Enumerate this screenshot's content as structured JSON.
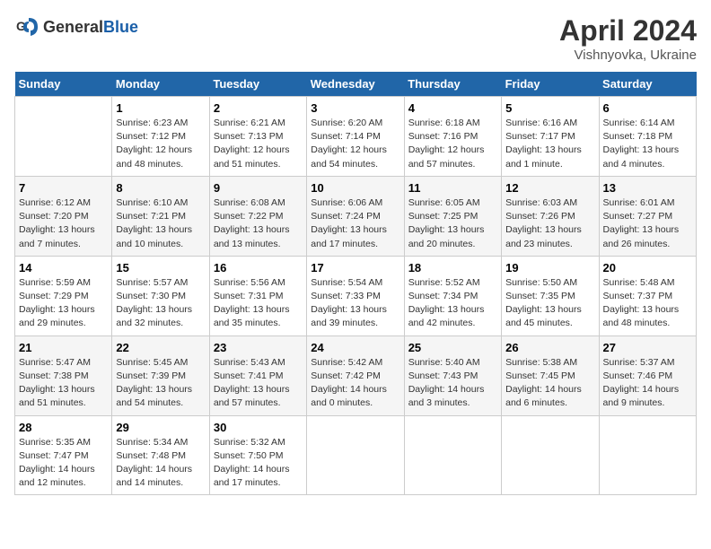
{
  "header": {
    "logo_general": "General",
    "logo_blue": "Blue",
    "title": "April 2024",
    "subtitle": "Vishnyovka, Ukraine"
  },
  "calendar": {
    "weekdays": [
      "Sunday",
      "Monday",
      "Tuesday",
      "Wednesday",
      "Thursday",
      "Friday",
      "Saturday"
    ],
    "weeks": [
      [
        {
          "day": "",
          "info": ""
        },
        {
          "day": "1",
          "info": "Sunrise: 6:23 AM\nSunset: 7:12 PM\nDaylight: 12 hours\nand 48 minutes."
        },
        {
          "day": "2",
          "info": "Sunrise: 6:21 AM\nSunset: 7:13 PM\nDaylight: 12 hours\nand 51 minutes."
        },
        {
          "day": "3",
          "info": "Sunrise: 6:20 AM\nSunset: 7:14 PM\nDaylight: 12 hours\nand 54 minutes."
        },
        {
          "day": "4",
          "info": "Sunrise: 6:18 AM\nSunset: 7:16 PM\nDaylight: 12 hours\nand 57 minutes."
        },
        {
          "day": "5",
          "info": "Sunrise: 6:16 AM\nSunset: 7:17 PM\nDaylight: 13 hours\nand 1 minute."
        },
        {
          "day": "6",
          "info": "Sunrise: 6:14 AM\nSunset: 7:18 PM\nDaylight: 13 hours\nand 4 minutes."
        }
      ],
      [
        {
          "day": "7",
          "info": "Sunrise: 6:12 AM\nSunset: 7:20 PM\nDaylight: 13 hours\nand 7 minutes."
        },
        {
          "day": "8",
          "info": "Sunrise: 6:10 AM\nSunset: 7:21 PM\nDaylight: 13 hours\nand 10 minutes."
        },
        {
          "day": "9",
          "info": "Sunrise: 6:08 AM\nSunset: 7:22 PM\nDaylight: 13 hours\nand 13 minutes."
        },
        {
          "day": "10",
          "info": "Sunrise: 6:06 AM\nSunset: 7:24 PM\nDaylight: 13 hours\nand 17 minutes."
        },
        {
          "day": "11",
          "info": "Sunrise: 6:05 AM\nSunset: 7:25 PM\nDaylight: 13 hours\nand 20 minutes."
        },
        {
          "day": "12",
          "info": "Sunrise: 6:03 AM\nSunset: 7:26 PM\nDaylight: 13 hours\nand 23 minutes."
        },
        {
          "day": "13",
          "info": "Sunrise: 6:01 AM\nSunset: 7:27 PM\nDaylight: 13 hours\nand 26 minutes."
        }
      ],
      [
        {
          "day": "14",
          "info": "Sunrise: 5:59 AM\nSunset: 7:29 PM\nDaylight: 13 hours\nand 29 minutes."
        },
        {
          "day": "15",
          "info": "Sunrise: 5:57 AM\nSunset: 7:30 PM\nDaylight: 13 hours\nand 32 minutes."
        },
        {
          "day": "16",
          "info": "Sunrise: 5:56 AM\nSunset: 7:31 PM\nDaylight: 13 hours\nand 35 minutes."
        },
        {
          "day": "17",
          "info": "Sunrise: 5:54 AM\nSunset: 7:33 PM\nDaylight: 13 hours\nand 39 minutes."
        },
        {
          "day": "18",
          "info": "Sunrise: 5:52 AM\nSunset: 7:34 PM\nDaylight: 13 hours\nand 42 minutes."
        },
        {
          "day": "19",
          "info": "Sunrise: 5:50 AM\nSunset: 7:35 PM\nDaylight: 13 hours\nand 45 minutes."
        },
        {
          "day": "20",
          "info": "Sunrise: 5:48 AM\nSunset: 7:37 PM\nDaylight: 13 hours\nand 48 minutes."
        }
      ],
      [
        {
          "day": "21",
          "info": "Sunrise: 5:47 AM\nSunset: 7:38 PM\nDaylight: 13 hours\nand 51 minutes."
        },
        {
          "day": "22",
          "info": "Sunrise: 5:45 AM\nSunset: 7:39 PM\nDaylight: 13 hours\nand 54 minutes."
        },
        {
          "day": "23",
          "info": "Sunrise: 5:43 AM\nSunset: 7:41 PM\nDaylight: 13 hours\nand 57 minutes."
        },
        {
          "day": "24",
          "info": "Sunrise: 5:42 AM\nSunset: 7:42 PM\nDaylight: 14 hours\nand 0 minutes."
        },
        {
          "day": "25",
          "info": "Sunrise: 5:40 AM\nSunset: 7:43 PM\nDaylight: 14 hours\nand 3 minutes."
        },
        {
          "day": "26",
          "info": "Sunrise: 5:38 AM\nSunset: 7:45 PM\nDaylight: 14 hours\nand 6 minutes."
        },
        {
          "day": "27",
          "info": "Sunrise: 5:37 AM\nSunset: 7:46 PM\nDaylight: 14 hours\nand 9 minutes."
        }
      ],
      [
        {
          "day": "28",
          "info": "Sunrise: 5:35 AM\nSunset: 7:47 PM\nDaylight: 14 hours\nand 12 minutes."
        },
        {
          "day": "29",
          "info": "Sunrise: 5:34 AM\nSunset: 7:48 PM\nDaylight: 14 hours\nand 14 minutes."
        },
        {
          "day": "30",
          "info": "Sunrise: 5:32 AM\nSunset: 7:50 PM\nDaylight: 14 hours\nand 17 minutes."
        },
        {
          "day": "",
          "info": ""
        },
        {
          "day": "",
          "info": ""
        },
        {
          "day": "",
          "info": ""
        },
        {
          "day": "",
          "info": ""
        }
      ]
    ]
  }
}
